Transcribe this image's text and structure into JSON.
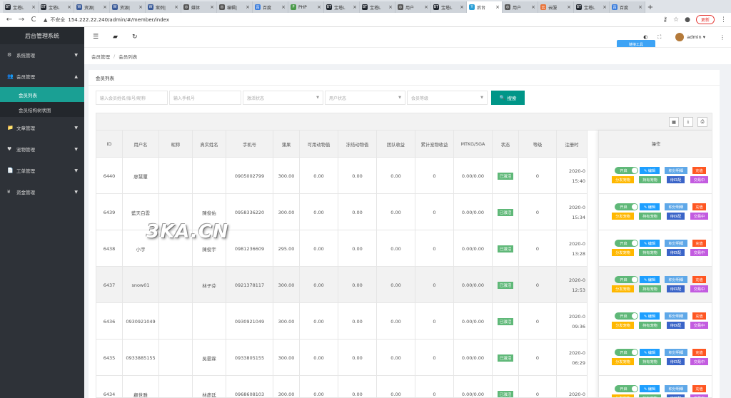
{
  "browser": {
    "tabs": [
      {
        "icon": "BT",
        "label": "宝塔L",
        "color": "#20262e",
        "active": false
      },
      {
        "icon": "BT",
        "label": "宝塔L",
        "color": "#20262e",
        "active": false
      },
      {
        "icon": "W",
        "label": "资源|",
        "color": "#3b5b99",
        "active": false
      },
      {
        "icon": "W",
        "label": "资源|",
        "color": "#3b5b99",
        "active": false
      },
      {
        "icon": "W",
        "label": "案例|",
        "color": "#3b5b99",
        "active": false
      },
      {
        "icon": "◎",
        "label": "媒体",
        "color": "#555555",
        "active": false
      },
      {
        "icon": "◎",
        "label": "编辑|",
        "color": "#555555",
        "active": false
      },
      {
        "icon": "百",
        "label": "百度",
        "color": "#3b7ddd",
        "active": false
      },
      {
        "icon": "P",
        "label": "PHP",
        "color": "#4a9a4a",
        "active": false
      },
      {
        "icon": "BT",
        "label": "宝塔L",
        "color": "#20262e",
        "active": false
      },
      {
        "icon": "BT",
        "label": "宝塔L",
        "color": "#20262e",
        "active": false
      },
      {
        "icon": "◎",
        "label": "用户",
        "color": "#555555",
        "active": false
      },
      {
        "icon": "BT",
        "label": "宝塔L",
        "color": "#20262e",
        "active": false
      },
      {
        "icon": "Y",
        "label": "后台",
        "color": "#2a9fd6",
        "active": true
      },
      {
        "icon": "◎",
        "label": "用户",
        "color": "#555555",
        "active": false
      },
      {
        "icon": "云",
        "label": "云服",
        "color": "#e8743b",
        "active": false
      },
      {
        "icon": "BT",
        "label": "宝塔L",
        "color": "#20262e",
        "active": false
      },
      {
        "icon": "百",
        "label": "百度",
        "color": "#3b7ddd",
        "active": false
      }
    ],
    "security_label": "不安全",
    "url": "154.222.22.240/admin/#/member/index",
    "update_label": "更新"
  },
  "sidebar": {
    "title": "后台管理系统",
    "menus": [
      {
        "icon": "⚙",
        "label": "系统管理",
        "arrow": "▼"
      },
      {
        "icon": "👥",
        "label": "会员管理",
        "arrow": "▲"
      }
    ],
    "submenu": [
      {
        "label": "会员列表",
        "active": true
      },
      {
        "label": "会员结构树状图",
        "active": false
      }
    ],
    "menus_after": [
      {
        "icon": "📁",
        "label": "文章管理",
        "arrow": "▼"
      },
      {
        "icon": "♥",
        "label": "宠物管理",
        "arrow": "▼"
      },
      {
        "icon": "📄",
        "label": "工单管理",
        "arrow": "▼"
      },
      {
        "icon": "¥",
        "label": "资金管理",
        "arrow": "▼"
      }
    ]
  },
  "header": {
    "username": "admin",
    "float_badge": "链接工具"
  },
  "breadcrumb": [
    "会员管理",
    "会员列表"
  ],
  "panel": {
    "title": "会员列表",
    "filters": {
      "name": "输入会员姓名/账号/昵称",
      "phone": "输入手机号",
      "activation": "激活状态",
      "user_status": "用户状态",
      "level": "会员等级",
      "search": "搜索"
    }
  },
  "table": {
    "columns": [
      "ID",
      "用户名",
      "昵称",
      "真实姓名",
      "手机号",
      "蒲果",
      "可用动物值",
      "冻结动物值",
      "团队收益",
      "累计宠物收益",
      "MTKG/SGA",
      "状态",
      "等级",
      "注册时"
    ],
    "op_header": "操作",
    "rows": [
      {
        "id": "6440",
        "username": "廖慧璽",
        "nickname": "",
        "realname": "",
        "phone": "0905002799",
        "fruit": "300.00",
        "avail": "0.00",
        "frozen": "0.00",
        "team": "0.00",
        "pet": "0",
        "mtkg": "0.00/0.00",
        "status": "已激活",
        "level": "0",
        "date1": "2020-0",
        "date2": "15:40"
      },
      {
        "id": "6439",
        "username": "藍天白雲",
        "nickname": "",
        "realname": "陳俊佑",
        "phone": "0958336220",
        "fruit": "300.00",
        "avail": "0.00",
        "frozen": "0.00",
        "team": "0.00",
        "pet": "0",
        "mtkg": "0.00/0.00",
        "status": "已激活",
        "level": "0",
        "date1": "2020-0",
        "date2": "15:34"
      },
      {
        "id": "6438",
        "username": "小宇",
        "nickname": "",
        "realname": "陳俊宇",
        "phone": "0981236609",
        "fruit": "295.00",
        "avail": "0.00",
        "frozen": "0.00",
        "team": "0.00",
        "pet": "0",
        "mtkg": "0.00/0.00",
        "status": "已激活",
        "level": "0",
        "date1": "2020-0",
        "date2": "13:28"
      },
      {
        "id": "6437",
        "username": "snow01",
        "nickname": "",
        "realname": "林子芬",
        "phone": "0921378117",
        "fruit": "300.00",
        "avail": "0.00",
        "frozen": "0.00",
        "team": "0.00",
        "pet": "0",
        "mtkg": "0.00/0.00",
        "status": "已激活",
        "level": "0",
        "date1": "2020-0",
        "date2": "12:53"
      },
      {
        "id": "6436",
        "username": "0930921049",
        "nickname": "",
        "realname": "",
        "phone": "0930921049",
        "fruit": "300.00",
        "avail": "0.00",
        "frozen": "0.00",
        "team": "0.00",
        "pet": "0",
        "mtkg": "0.00/0.00",
        "status": "已激活",
        "level": "0",
        "date1": "2020-0",
        "date2": "09:36"
      },
      {
        "id": "6435",
        "username": "0933885155",
        "nickname": "",
        "realname": "吳晏霖",
        "phone": "0933805155",
        "fruit": "300.00",
        "avail": "0.00",
        "frozen": "0.00",
        "team": "0.00",
        "pet": "0",
        "mtkg": "0.00/0.00",
        "status": "已激活",
        "level": "0",
        "date1": "2020-0",
        "date2": "06:29"
      },
      {
        "id": "6434",
        "username": "顧世雅",
        "nickname": "",
        "realname": "林彥廷",
        "phone": "0968608103",
        "fruit": "300.00",
        "avail": "0.00",
        "frozen": "0.00",
        "team": "0.00",
        "pet": "0",
        "mtkg": "0.00/0.00",
        "status": "已激活",
        "level": "0",
        "date1": "2020-0",
        "date2": ""
      }
    ],
    "highlight_row": 3,
    "op_buttons": {
      "toggle": "开启",
      "edit": "✎ 编辑",
      "points": "积分明细",
      "recharge": "充值",
      "distribute": "分发宠物",
      "hold": "持有宠物",
      "match": "待匹配",
      "trading": "交易中"
    }
  },
  "watermark": "3KA.CN",
  "colors": {
    "sidebar_bg": "#2e3238",
    "active_teal": "#1aa094",
    "search_btn": "#009688",
    "toggle_green": "#5fb878",
    "edit_blue": "#1e9fff",
    "points_blue": "#5fa8e8",
    "recharge_red": "#ff5722",
    "distribute_orange": "#ffb800",
    "hold_green": "#5fb878",
    "match_blue": "#3a64c8",
    "trading_purple": "#c35ce0"
  }
}
